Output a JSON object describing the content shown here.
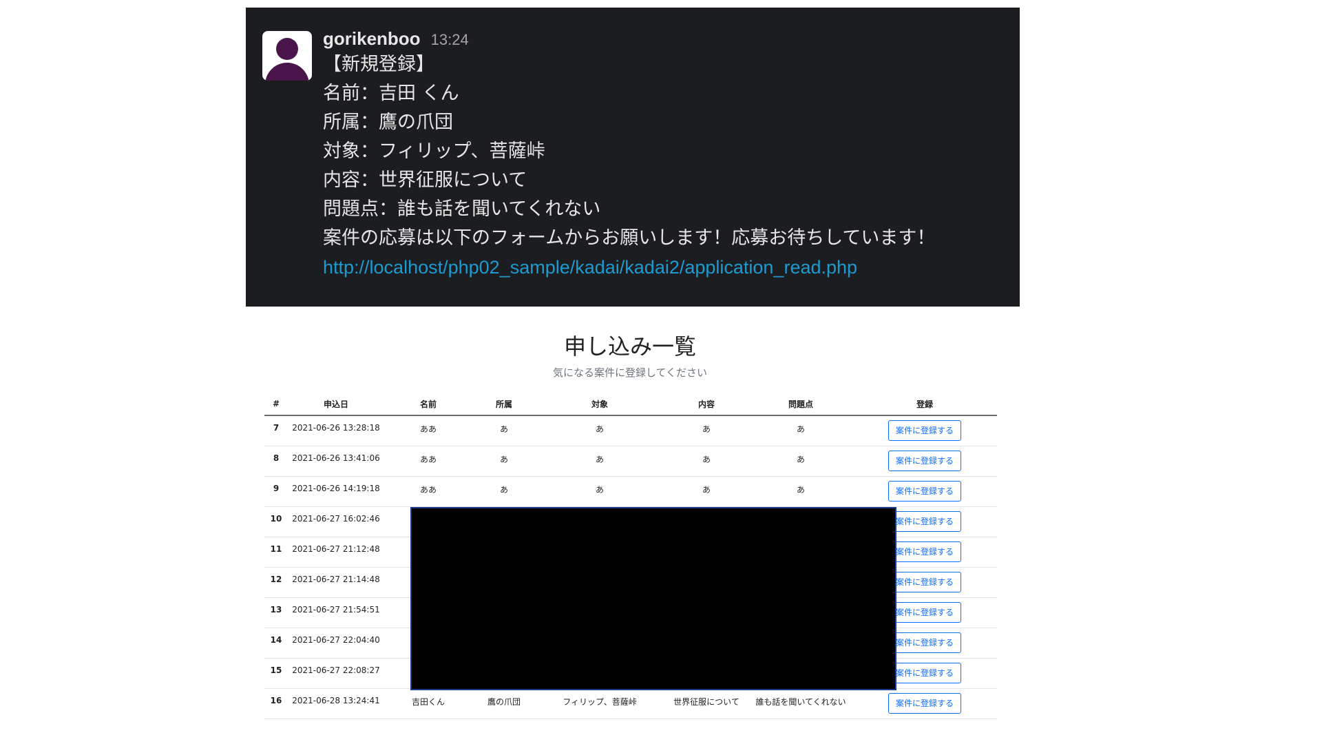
{
  "slack_message": {
    "username": "gorikenboo",
    "time": "13:24",
    "lines": [
      "【新規登録】",
      "名前：吉田 くん",
      "所属：鷹の爪団",
      "対象：フィリップ、菩薩峠",
      "内容：世界征服について",
      "問題点：誰も話を聞いてくれない",
      "案件の応募は以下のフォームからお願いします！応募お待ちしています！"
    ],
    "link": "http://localhost/php02_sample/kadai/kadai2/application_read.php"
  },
  "listing": {
    "title": "申し込み一覧",
    "subtitle": "気になる案件に登録してください",
    "columns": [
      "#",
      "申込日",
      "名前",
      "所属",
      "対象",
      "内容",
      "問題点",
      "登録"
    ],
    "button_label": "案件に登録する",
    "rows": [
      {
        "id": "7",
        "date": "2021-06-26 13:28:18",
        "name": "ああ",
        "affiliation": "あ",
        "target": "あ",
        "content": "あ",
        "problem": "あ"
      },
      {
        "id": "8",
        "date": "2021-06-26 13:41:06",
        "name": "ああ",
        "affiliation": "あ",
        "target": "あ",
        "content": "あ",
        "problem": "あ"
      },
      {
        "id": "9",
        "date": "2021-06-26 14:19:18",
        "name": "ああ",
        "affiliation": "あ",
        "target": "あ",
        "content": "あ",
        "problem": "あ"
      },
      {
        "id": "10",
        "date": "2021-06-27 16:02:46",
        "name": "",
        "affiliation": "",
        "target": "",
        "content": "",
        "problem": ""
      },
      {
        "id": "11",
        "date": "2021-06-27 21:12:48",
        "name": "",
        "affiliation": "",
        "target": "",
        "content": "",
        "problem": ""
      },
      {
        "id": "12",
        "date": "2021-06-27 21:14:48",
        "name": "",
        "affiliation": "",
        "target": "",
        "content": "",
        "problem": ""
      },
      {
        "id": "13",
        "date": "2021-06-27 21:54:51",
        "name": "",
        "affiliation": "",
        "target": "",
        "content": "",
        "problem": ""
      },
      {
        "id": "14",
        "date": "2021-06-27 22:04:40",
        "name": "",
        "affiliation": "",
        "target": "",
        "content": "",
        "problem": ""
      },
      {
        "id": "15",
        "date": "2021-06-27 22:08:27",
        "name": "",
        "affiliation": "",
        "target": "",
        "content": "",
        "problem": ""
      },
      {
        "id": "16",
        "date": "2021-06-28 13:24:41",
        "name": "吉田くん",
        "affiliation": "鷹の爪団",
        "target": "フィリップ、菩薩峠",
        "content": "世界征服について",
        "problem": "誰も話を聞いてくれない"
      }
    ]
  },
  "colors": {
    "slack_bg": "#1b1d21",
    "link": "#1d9bd1",
    "avatar": "#4a154b",
    "button": "#0d6efd",
    "redaction": "#000000"
  }
}
